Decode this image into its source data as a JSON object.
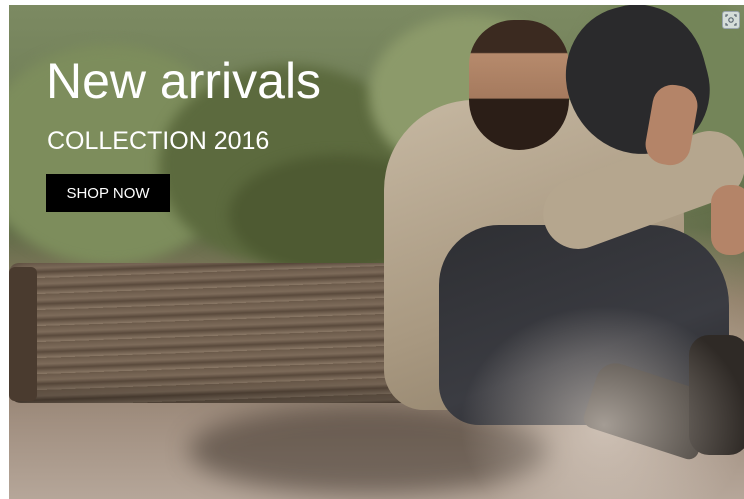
{
  "banner": {
    "headline": "New arrivals",
    "subheadline": "COLLECTION 2016",
    "cta_label": "SHOP NOW"
  },
  "colors": {
    "text": "#ffffff",
    "button_bg": "#000000"
  },
  "icons": {
    "corner": "screenshot-icon"
  }
}
